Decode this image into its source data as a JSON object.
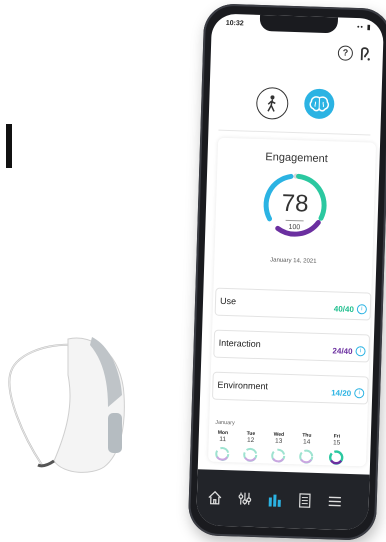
{
  "status_bar": {
    "time": "10:32",
    "icons": "•• ▮"
  },
  "header": {
    "help_icon_glyph": "?",
    "ear_icon": "ear-icon"
  },
  "modes": [
    {
      "name": "body-mode",
      "icon": "person-walking-icon",
      "active": false
    },
    {
      "name": "brain-mode",
      "icon": "brain-icon",
      "active": true,
      "color": "#2bb3e3"
    }
  ],
  "engagement": {
    "title": "Engagement",
    "score": "78",
    "max": "100",
    "date": "January 14, 2021",
    "score_value": 78,
    "colors": {
      "green": "#2bc8a0",
      "blue": "#2bb3e3",
      "purple": "#6b2fa0",
      "gray": "#d8d8d8"
    }
  },
  "metrics": [
    {
      "label": "Use",
      "value": "40/40",
      "color": "#1fbf8e"
    },
    {
      "label": "Interaction",
      "value": "24/40",
      "color": "#6b2fa0"
    },
    {
      "label": "Environment",
      "value": "14/20",
      "color": "#2bb3e3"
    }
  ],
  "calendar": {
    "month": "January",
    "days": [
      {
        "name": "Mon",
        "date": "11"
      },
      {
        "name": "Tue",
        "date": "12"
      },
      {
        "name": "Wed",
        "date": "13"
      },
      {
        "name": "Thu",
        "date": "14"
      },
      {
        "name": "Fri",
        "date": "15"
      }
    ]
  },
  "nav": [
    {
      "icon": "home-icon"
    },
    {
      "icon": "sliders-icon"
    },
    {
      "icon": "bar-chart-icon",
      "active": true
    },
    {
      "icon": "checklist-icon"
    },
    {
      "icon": "menu-icon"
    }
  ]
}
